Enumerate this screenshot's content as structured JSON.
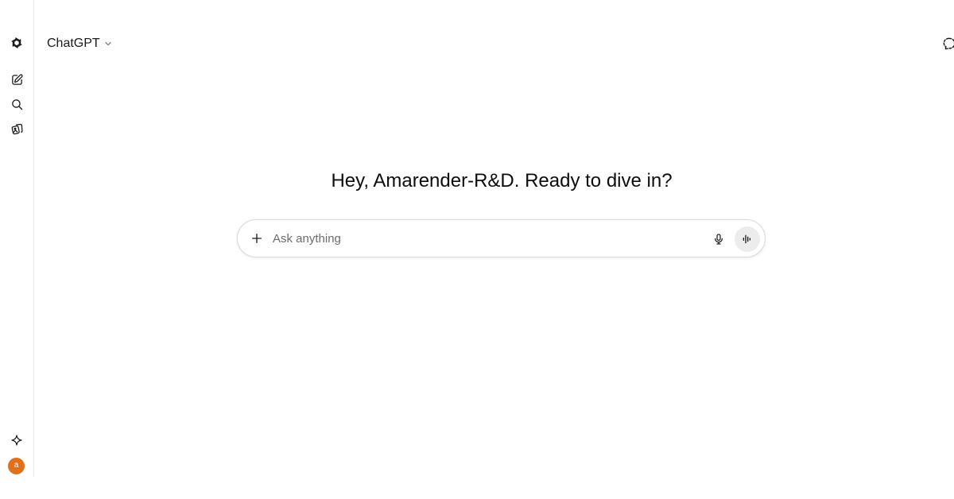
{
  "header": {
    "model_name": "ChatGPT"
  },
  "main": {
    "greeting": "Hey, Amarender-R&D. Ready to dive in?"
  },
  "composer": {
    "placeholder": "Ask anything"
  },
  "user": {
    "avatar_initial": "a"
  },
  "icons": {
    "logo": "openai-logo-icon",
    "new_chat": "new-chat-icon",
    "search": "search-icon",
    "library": "library-icon",
    "sparkle": "sparkle-icon",
    "model_chevron": "chevron-down-icon",
    "temporary_chat": "temporary-chat-icon",
    "add": "plus-icon",
    "microphone": "microphone-icon",
    "voice_mode": "voice-waveform-icon"
  },
  "colors": {
    "avatar": "#e0701d",
    "voice_button_bg": "#ececec",
    "composer_border": "#d9d9d9"
  }
}
